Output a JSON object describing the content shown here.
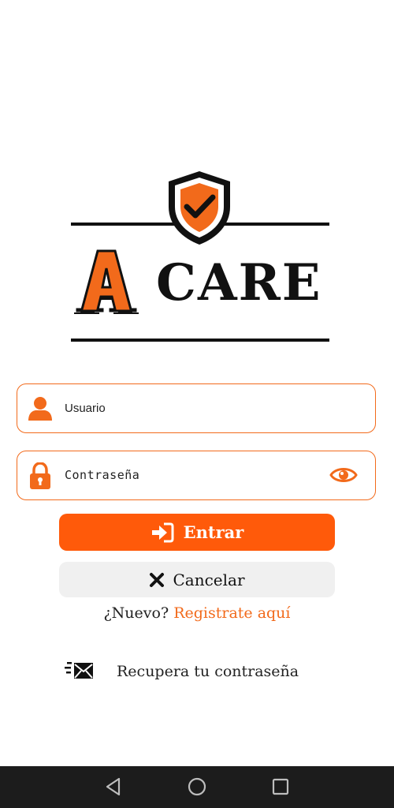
{
  "logo": {
    "brand_letter": "A",
    "brand_name": "CARE"
  },
  "colors": {
    "accent": "#ff5a0a",
    "accent_border": "#f26a1b",
    "cancel_bg": "#f0f0f0",
    "navbar_bg": "#1c1c1c"
  },
  "login_form": {
    "username_placeholder": "Usuario",
    "password_placeholder": "Contraseña",
    "user_icon": "user-icon",
    "lock_icon": "lock-icon",
    "eye_icon": "eye-icon"
  },
  "buttons": {
    "enter_label": "Entrar",
    "enter_icon": "sign-in-icon",
    "cancel_label": "Cancelar",
    "cancel_icon": "close-icon"
  },
  "register": {
    "prompt": "¿Nuevo?",
    "link": "Registrate aquí"
  },
  "recover": {
    "label": "Recupera tu contraseña",
    "icon": "envelope-icon"
  },
  "system_nav": {
    "back_icon": "back-icon",
    "home_icon": "home-icon",
    "recent_icon": "recent-apps-icon"
  }
}
